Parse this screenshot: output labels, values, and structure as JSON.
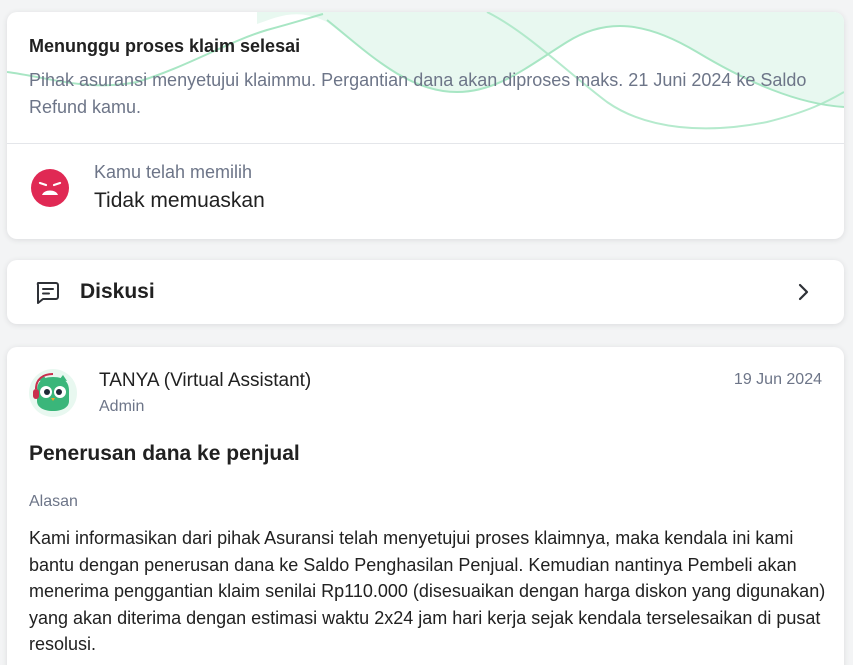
{
  "status": {
    "title": "Menunggu proses klaim selesai",
    "description": "Pihak asuransi menyetujui klaimmu. Pergantian dana akan diproses maks. 21 Juni 2024 ke Saldo Refund kamu."
  },
  "rating": {
    "label": "Kamu telah memilih",
    "value": "Tidak memuaskan",
    "icon": "sad-face-icon",
    "color": "#e02954"
  },
  "discussion": {
    "label": "Diskusi",
    "icon": "chat-icon"
  },
  "message": {
    "sender": "TANYA (Virtual Assistant)",
    "role": "Admin",
    "date": "19 Jun 2024",
    "title": "Penerusan dana ke penjual",
    "reason_label": "Alasan",
    "body": "Kami informasikan dari pihak Asuransi telah menyetujui proses klaimnya, maka kendala ini kami bantu dengan penerusan dana ke Saldo Penghasilan Penjual. Kemudian nantinya Pembeli akan menerima penggantian klaim senilai Rp110.000 (disesuaikan dengan harga diskon yang digunakan) yang akan diterima dengan estimasi waktu 2x24 jam hari kerja sejak kendala terselesaikan di pusat resolusi."
  },
  "colors": {
    "accent_green": "#a8e6c4",
    "mint_bg": "#e8f8f0"
  }
}
